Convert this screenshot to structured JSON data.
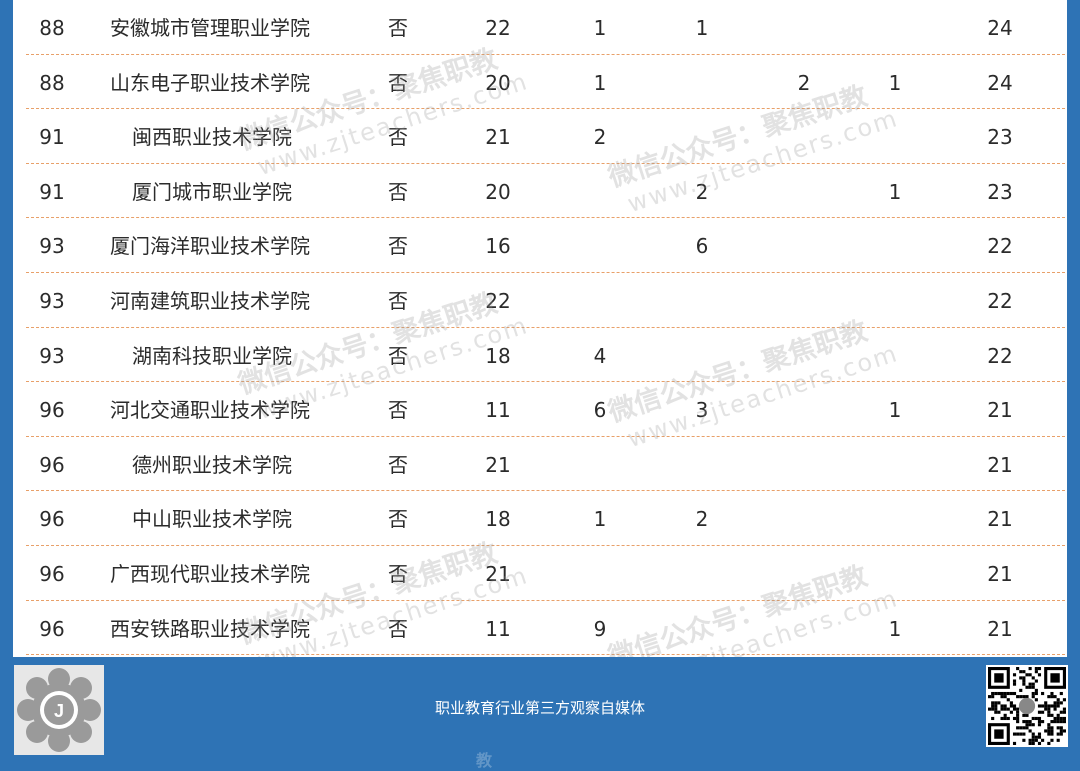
{
  "table": {
    "rows": [
      {
        "rank": "88",
        "name": "安徽城市管理职业学院",
        "indent": false,
        "yn": "否",
        "n1": "22",
        "n2": "1",
        "n3": "1",
        "n4": "",
        "n5": "",
        "total": "24"
      },
      {
        "rank": "88",
        "name": "山东电子职业技术学院",
        "indent": false,
        "yn": "否",
        "n1": "20",
        "n2": "1",
        "n3": "",
        "n4": "2",
        "n5": "1",
        "total": "24"
      },
      {
        "rank": "91",
        "name": "闽西职业技术学院",
        "indent": true,
        "yn": "否",
        "n1": "21",
        "n2": "2",
        "n3": "",
        "n4": "",
        "n5": "",
        "total": "23"
      },
      {
        "rank": "91",
        "name": "厦门城市职业学院",
        "indent": true,
        "yn": "否",
        "n1": "20",
        "n2": "",
        "n3": "2",
        "n4": "",
        "n5": "1",
        "total": "23"
      },
      {
        "rank": "93",
        "name": "厦门海洋职业技术学院",
        "indent": false,
        "yn": "否",
        "n1": "16",
        "n2": "",
        "n3": "6",
        "n4": "",
        "n5": "",
        "total": "22"
      },
      {
        "rank": "93",
        "name": "河南建筑职业技术学院",
        "indent": false,
        "yn": "否",
        "n1": "22",
        "n2": "",
        "n3": "",
        "n4": "",
        "n5": "",
        "total": "22"
      },
      {
        "rank": "93",
        "name": "湖南科技职业学院",
        "indent": true,
        "yn": "否",
        "n1": "18",
        "n2": "4",
        "n3": "",
        "n4": "",
        "n5": "",
        "total": "22"
      },
      {
        "rank": "96",
        "name": "河北交通职业技术学院",
        "indent": false,
        "yn": "否",
        "n1": "11",
        "n2": "6",
        "n3": "3",
        "n4": "",
        "n5": "1",
        "total": "21"
      },
      {
        "rank": "96",
        "name": "德州职业技术学院",
        "indent": true,
        "yn": "否",
        "n1": "21",
        "n2": "",
        "n3": "",
        "n4": "",
        "n5": "",
        "total": "21"
      },
      {
        "rank": "96",
        "name": "中山职业技术学院",
        "indent": true,
        "yn": "否",
        "n1": "18",
        "n2": "1",
        "n3": "2",
        "n4": "",
        "n5": "",
        "total": "21"
      },
      {
        "rank": "96",
        "name": "广西现代职业技术学院",
        "indent": false,
        "yn": "否",
        "n1": "21",
        "n2": "",
        "n3": "",
        "n4": "",
        "n5": "",
        "total": "21"
      },
      {
        "rank": "96",
        "name": "西安铁路职业技术学院",
        "indent": false,
        "yn": "否",
        "n1": "11",
        "n2": "9",
        "n3": "",
        "n4": "",
        "n5": "1",
        "total": "21"
      }
    ]
  },
  "watermark": {
    "text": "微信公众号：聚焦职教",
    "url": "www.zjteachers.com"
  },
  "footer": {
    "slogan": "职业教育行业第三方观察自媒体",
    "logo_letter": "J",
    "partial_text": "教"
  },
  "colors": {
    "frame": "#2e73b5",
    "row_divider": "#e8a069",
    "text": "#2b2b2b"
  }
}
